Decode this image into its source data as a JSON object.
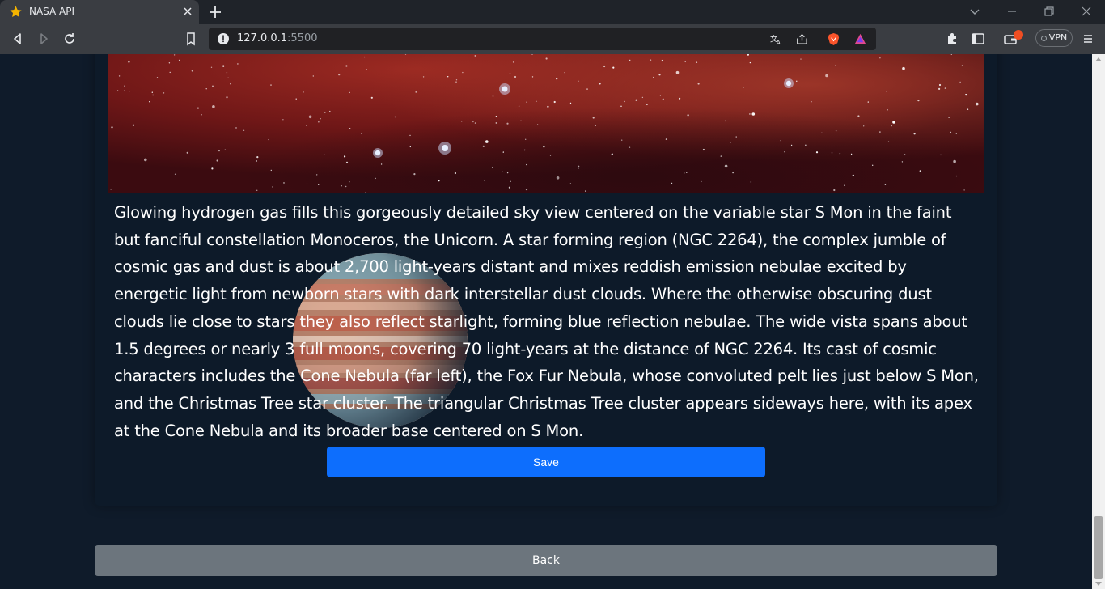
{
  "browser": {
    "tab_title": "NASA API",
    "url_host": "127.0.0.1",
    "url_port": ":5500",
    "vpn_label": "VPN"
  },
  "page": {
    "description": "Glowing hydrogen gas fills this gorgeously detailed sky view centered on the variable star S Mon in the faint but fanciful constellation Monoceros, the Unicorn. A star forming region (NGC 2264), the complex jumble of cosmic gas and dust is about 2,700 light-years distant and mixes reddish emission nebulae excited by energetic light from newborn stars with dark interstellar dust clouds. Where the otherwise obscuring dust clouds lie close to stars they also reflect starlight, forming blue reflection nebulae. The wide vista spans about 1.5 degrees or nearly 3 full moons, covering 70 light-years at the distance of NGC 2264. Its cast of cosmic characters includes the Cone Nebula (far left), the Fox Fur Nebula, whose convoluted pelt lies just below S Mon, and the Christmas Tree star cluster. The triangular Christmas Tree cluster appears sideways here, with its apex at the Cone Nebula and its broader base centered on S Mon.",
    "save_label": "Save",
    "back_label": "Back"
  },
  "colors": {
    "page_bg": "#0f1b2a",
    "primary": "#0d6efd",
    "secondary": "#6c757d"
  }
}
